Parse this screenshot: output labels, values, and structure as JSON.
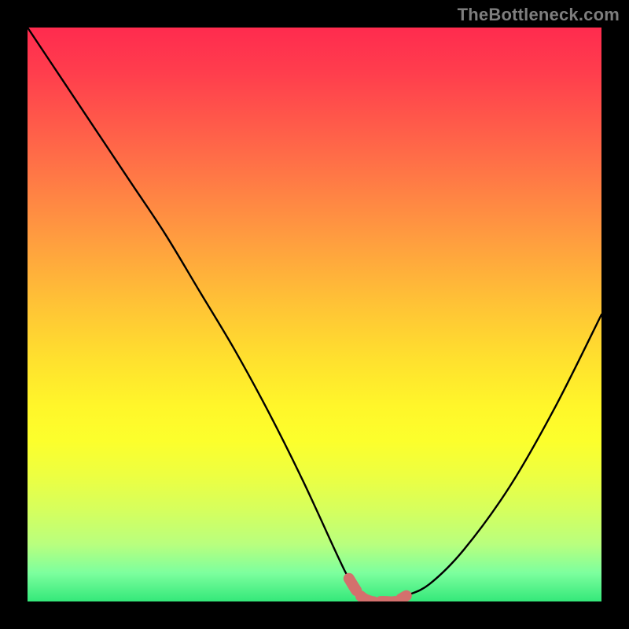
{
  "watermark": "TheBottleneck.com",
  "chart_data": {
    "type": "line",
    "title": "",
    "xlabel": "",
    "ylabel": "",
    "xlim": [
      0,
      100
    ],
    "ylim": [
      0,
      100
    ],
    "series": [
      {
        "name": "bottleneck-curve",
        "x": [
          0,
          6,
          12,
          18,
          24,
          30,
          36,
          42,
          48,
          54,
          56,
          58,
          60,
          62,
          64,
          66,
          70,
          76,
          84,
          92,
          100
        ],
        "y": [
          100,
          91,
          82,
          73,
          64,
          54,
          44,
          33,
          21,
          8,
          4,
          1,
          0,
          0,
          0,
          1,
          3,
          9,
          20,
          34,
          50
        ]
      }
    ],
    "highlight_segment": {
      "name": "trough-highlight",
      "x_start": 55,
      "x_end": 67,
      "color": "#d4706d"
    },
    "gradient_stops": [
      {
        "pos": 0.0,
        "color": "#ff2b4e"
      },
      {
        "pos": 0.22,
        "color": "#ff6b48"
      },
      {
        "pos": 0.48,
        "color": "#ffc236"
      },
      {
        "pos": 0.72,
        "color": "#fcff2c"
      },
      {
        "pos": 0.9,
        "color": "#b9ff7e"
      },
      {
        "pos": 1.0,
        "color": "#34e87a"
      }
    ]
  }
}
